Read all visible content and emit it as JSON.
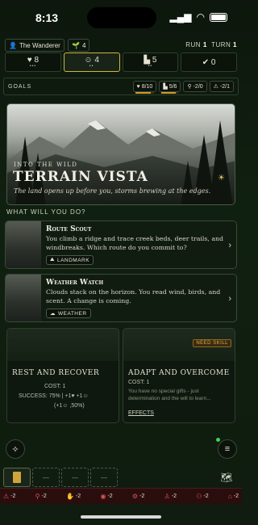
{
  "status": {
    "time": "8:13"
  },
  "topbar": {
    "character": "The Wanderer",
    "sprout_count": "4",
    "run_label": "RUN",
    "run_value": "1",
    "turn_label": "TURN",
    "turn_value": "1"
  },
  "stats": [
    {
      "icon": "heart-icon",
      "value": "8",
      "dots": "•••"
    },
    {
      "icon": "face-icon",
      "value": "4",
      "dots": "••"
    },
    {
      "icon": "resource-icon",
      "value": "5",
      "dots": "••"
    },
    {
      "icon": "check-icon",
      "value": "0",
      "dots": ""
    }
  ],
  "goals": {
    "label": "GOALS",
    "items": [
      {
        "icon": "heart-icon",
        "value": "8/10",
        "progress": 0.8
      },
      {
        "icon": "resource-icon",
        "value": "5/6",
        "progress": 0.83
      },
      {
        "icon": "pin-icon",
        "value": "-2/0",
        "progress": 0
      },
      {
        "icon": "warning-icon",
        "value": "-2/1",
        "progress": 0
      }
    ]
  },
  "hero": {
    "eyebrow": "INTO THE WILD",
    "title": "TERRAIN VISTA",
    "subtitle": "The land opens up before you, storms brewing at the edges."
  },
  "section_label": "WHAT WILL YOU DO?",
  "options": [
    {
      "title": "Route Scout",
      "body": "You climb a ridge and trace creek beds, deer trails, and windbreaks. Which route do you commit to?",
      "tag": "LANDMARK",
      "tag_icon": "hiker-icon"
    },
    {
      "title": "Weather Watch",
      "body": "Clouds stack on the horizon. You read wind, birds, and scent. A change is coming.",
      "tag": "WEATHER",
      "tag_icon": "cloud-icon"
    }
  ],
  "cards": [
    {
      "title": "REST AND RECOVER",
      "cost_label": "COST: 1",
      "success_line": "SUCCESS: 75% | +1♥ +1☺",
      "extra_line": "(+1☺ ,50%)"
    },
    {
      "title": "ADAPT AND OVERCOME",
      "badge": "NEED SKILL",
      "cost_label": "COST: 1",
      "body": "You have no special gifts - just determination and the will to learn...",
      "effects_label": "EFFECTS"
    }
  ],
  "inventory": {
    "slots": [
      "",
      "—",
      "—",
      "—"
    ]
  },
  "effects": [
    {
      "icon": "warning-icon",
      "value": "-2"
    },
    {
      "icon": "pin-icon",
      "value": "-2"
    },
    {
      "icon": "hand-icon",
      "value": "-2"
    },
    {
      "icon": "eye-icon",
      "value": "-2"
    },
    {
      "icon": "gear-icon",
      "value": "-2"
    },
    {
      "icon": "person-icon",
      "value": "-2"
    },
    {
      "icon": "group-icon",
      "value": "-2"
    },
    {
      "icon": "home-icon",
      "value": "-2"
    }
  ],
  "colors": {
    "accent_gold": "#cfb63d",
    "danger_red": "#e25050",
    "panel_green": "#111c11"
  }
}
